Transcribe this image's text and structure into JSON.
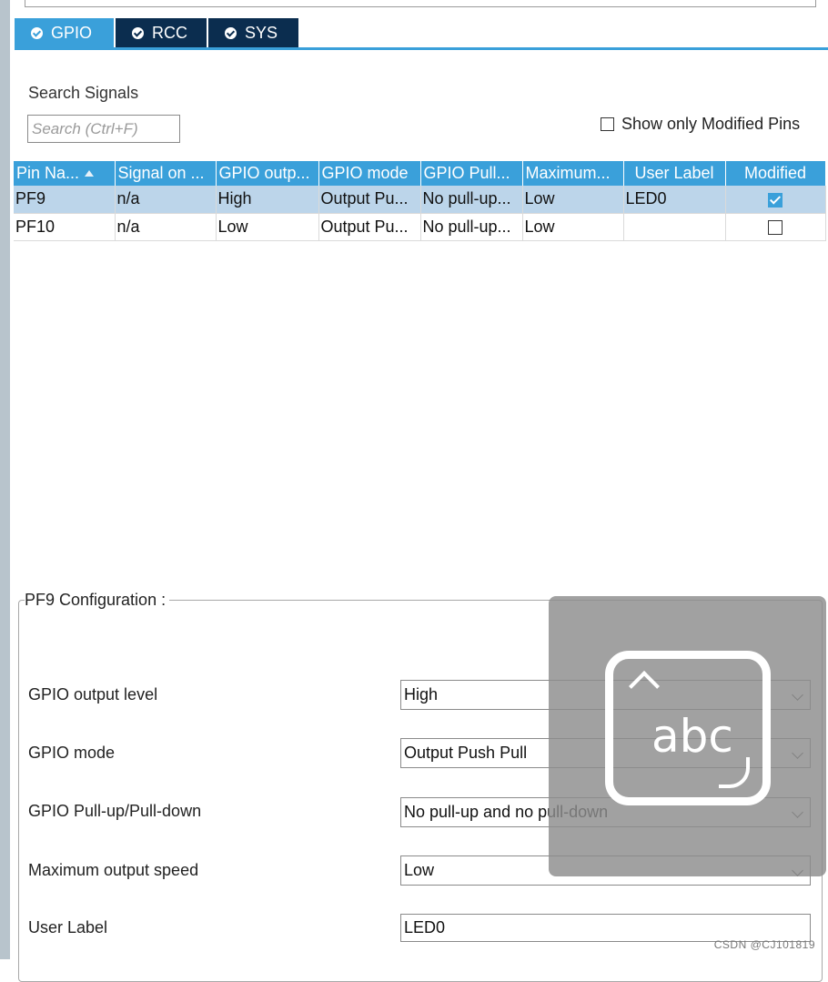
{
  "tabs": [
    {
      "label": "GPIO",
      "active": true,
      "icon": "check-circle-icon"
    },
    {
      "label": "RCC",
      "active": false,
      "icon": "check-circle-icon"
    },
    {
      "label": "SYS",
      "active": false,
      "icon": "check-circle-icon"
    }
  ],
  "search": {
    "title": "Search Signals",
    "placeholder": "Search (Ctrl+F)",
    "show_modified_label": "Show only Modified Pins",
    "show_modified_checked": false
  },
  "table": {
    "columns": [
      "Pin Na...",
      "Signal on ...",
      "GPIO outp...",
      "GPIO mode",
      "GPIO Pull...",
      "Maximum...",
      "User Label",
      "Modified"
    ],
    "rows": [
      {
        "pin": "PF9",
        "signal": "n/a",
        "output": "High",
        "mode": "Output Pu...",
        "pull": "No pull-up...",
        "speed": "Low",
        "label": "LED0",
        "modified": true
      },
      {
        "pin": "PF10",
        "signal": "n/a",
        "output": "Low",
        "mode": "Output Pu...",
        "pull": "No pull-up...",
        "speed": "Low",
        "label": "",
        "modified": false
      }
    ]
  },
  "config": {
    "title": "PF9 Configuration :",
    "fields": [
      {
        "label": "GPIO output level",
        "value": "High"
      },
      {
        "label": "GPIO mode",
        "value": "Output Push Pull"
      },
      {
        "label": "GPIO Pull-up/Pull-down",
        "value": "No pull-up and no pull-down"
      },
      {
        "label": "Maximum output speed",
        "value": "Low"
      }
    ],
    "user_label": {
      "label": "User Label",
      "value": "LED0"
    }
  },
  "overlay": {
    "text": "abc",
    "icon": "keyboard-input-icon"
  },
  "watermark": "CSDN @CJ101819",
  "colors": {
    "accent": "#3aa0da",
    "tab_dark": "#0b2d4f",
    "selected_row": "#bcd5ea"
  }
}
